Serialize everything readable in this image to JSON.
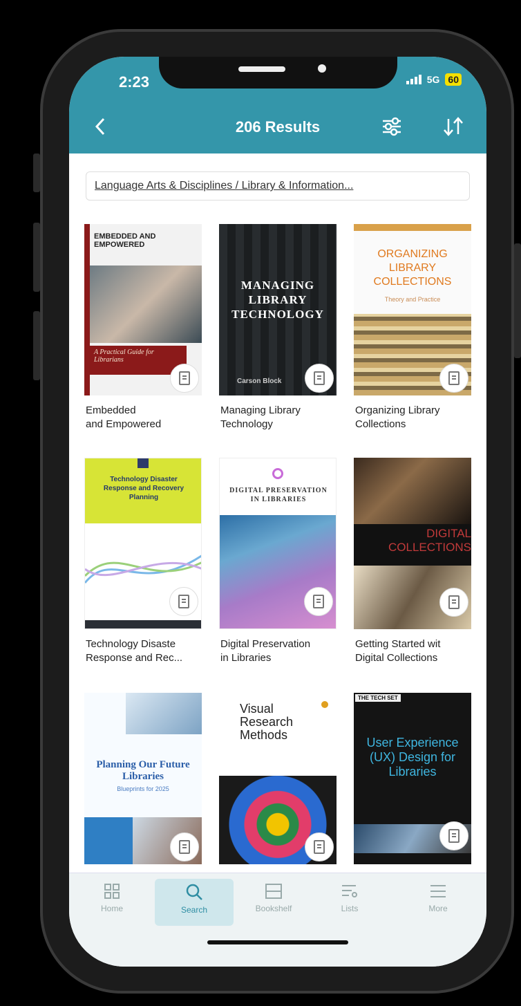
{
  "status": {
    "time": "2:23",
    "network": "5G",
    "battery": "60"
  },
  "header": {
    "title": "206 Results",
    "back_icon": "chevron-left-icon",
    "filter_icon": "filter-sliders-icon",
    "sort_icon": "sort-arrows-icon"
  },
  "breadcrumb": "Language Arts & Disciplines / Library & Information...",
  "books": [
    {
      "title_l1": "Embedded",
      "title_l2": "and Empowered",
      "cover_text": "EMBEDDED AND EMPOWERED",
      "cover_sub": "A Practical Guide for Librarians"
    },
    {
      "title_l1": "Managing Library",
      "title_l2": "Technology",
      "cover_text": "MANAGING LIBRARY TECHNOLOGY",
      "cover_sub": "Carson Block"
    },
    {
      "title_l1": "Organizing Library",
      "title_l2": "Collections",
      "cover_text": "ORGANIZING LIBRARY COLLECTIONS",
      "cover_sub": "Theory and Practice"
    },
    {
      "title_l1": "Technology Disaste",
      "title_l2": "Response and Rec...",
      "cover_text": "Technology Disaster Response and Recovery Planning",
      "cover_sub": ""
    },
    {
      "title_l1": "Digital Preservation",
      "title_l2": "in Libraries",
      "cover_text": "DIGITAL PRESERVATION IN LIBRARIES",
      "cover_sub": ""
    },
    {
      "title_l1": "Getting Started wit",
      "title_l2": "Digital Collections",
      "cover_text": "DIGITAL COLLECTIONS",
      "cover_sub": ""
    },
    {
      "title_l1": "",
      "title_l2": "",
      "cover_text": "Planning Our Future Libraries",
      "cover_sub": "Blueprints for 2025"
    },
    {
      "title_l1": "",
      "title_l2": "",
      "cover_text": "Visual Research Methods",
      "cover_sub": ""
    },
    {
      "title_l1": "",
      "title_l2": "",
      "cover_text": "User Experience (UX) Design for Libraries",
      "cover_sub": "THE TECH SET"
    }
  ],
  "tabs": [
    {
      "label": "Home",
      "icon": "grid-icon"
    },
    {
      "label": "Search",
      "icon": "search-icon"
    },
    {
      "label": "Bookshelf",
      "icon": "bookshelf-icon"
    },
    {
      "label": "Lists",
      "icon": "list-icon"
    },
    {
      "label": "More",
      "icon": "menu-icon"
    }
  ],
  "colors": {
    "accent": "#3496aa",
    "active_tab_bg": "#cfe7ec"
  }
}
